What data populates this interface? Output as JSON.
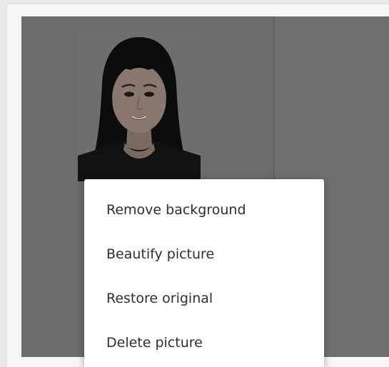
{
  "photo": {
    "subject_description": "portrait of woman with long dark hair and bangs on white background"
  },
  "context_menu": {
    "items": [
      {
        "label": "Remove background"
      },
      {
        "label": "Beautify picture"
      },
      {
        "label": "Restore original"
      },
      {
        "label": "Delete picture"
      }
    ]
  },
  "colors": {
    "canvas": "#6c6c6c",
    "menu_background": "#ffffff",
    "menu_text": "#2f2f2f"
  }
}
